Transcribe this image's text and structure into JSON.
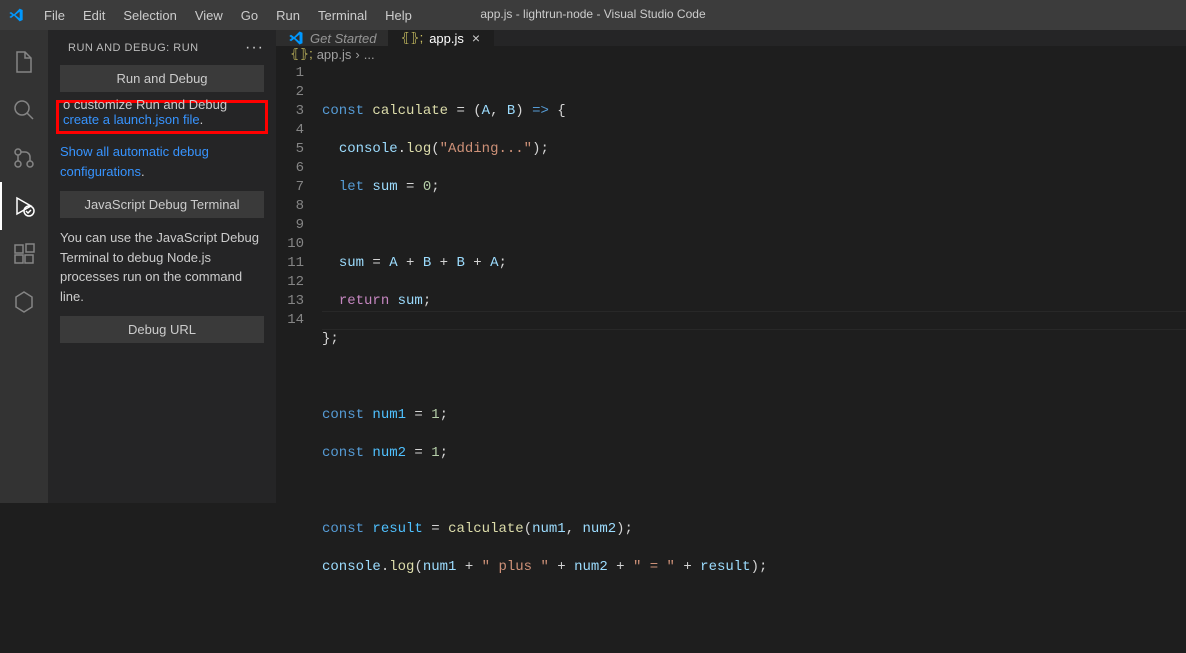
{
  "window_title": "app.js - lightrun-node - Visual Studio Code",
  "menu": [
    "File",
    "Edit",
    "Selection",
    "View",
    "Go",
    "Run",
    "Terminal",
    "Help"
  ],
  "sidebar": {
    "title": "RUN AND DEBUG: RUN",
    "run_debug_btn": "Run and Debug",
    "customize_top": "o customize Run and Debug",
    "create_launch_link": "create a launch.json file",
    "show_all_link": "Show all automatic debug configurations",
    "js_terminal_btn": "JavaScript Debug Terminal",
    "js_terminal_desc": "You can use the JavaScript Debug Terminal to debug Node.js processes run on the command line.",
    "debug_url_btn": "Debug URL"
  },
  "tabs": {
    "get_started": "Get Started",
    "active": "app.js"
  },
  "breadcrumb": {
    "file": "app.js",
    "sep": "›",
    "rest": "..."
  },
  "code": {
    "lines": 14,
    "l1": {
      "a": "const ",
      "b": "calculate",
      "c": " = (",
      "d": "A",
      "e": ", ",
      "f": "B",
      "g": ") ",
      "h": "=>",
      "i": " {"
    },
    "l2": {
      "a": "console",
      "b": ".",
      "c": "log",
      "d": "(",
      "e": "\"Adding...\"",
      "f": ");"
    },
    "l3": {
      "a": "let ",
      "b": "sum",
      "c": " = ",
      "d": "0",
      "e": ";"
    },
    "l5a": "sum",
    "l5b": " = ",
    "l5c": "A",
    "l5d": " + ",
    "l5e": "B",
    "l5f": " + ",
    "l5g": "B",
    "l5h": " + ",
    "l5i": "A",
    "l5j": ";",
    "l6a": "return ",
    "l6b": "sum",
    "l6c": ";",
    "l7": "};",
    "l9a": "const ",
    "l9b": "num1",
    "l9c": " = ",
    "l9d": "1",
    "l9e": ";",
    "l10a": "const ",
    "l10b": "num2",
    "l10c": " = ",
    "l10d": "1",
    "l10e": ";",
    "l12a": "const ",
    "l12b": "result",
    "l12c": " = ",
    "l12d": "calculate",
    "l12e": "(",
    "l12f": "num1",
    "l12g": ", ",
    "l12h": "num2",
    "l12i": ");",
    "l13a": "console",
    "l13b": ".",
    "l13c": "log",
    "l13d": "(",
    "l13e": "num1",
    "l13f": " + ",
    "l13g": "\" plus \"",
    "l13h": " + ",
    "l13i": "num2",
    "l13j": " + ",
    "l13k": "\" = \"",
    "l13l": " + ",
    "l13m": "result",
    "l13n": ");"
  }
}
